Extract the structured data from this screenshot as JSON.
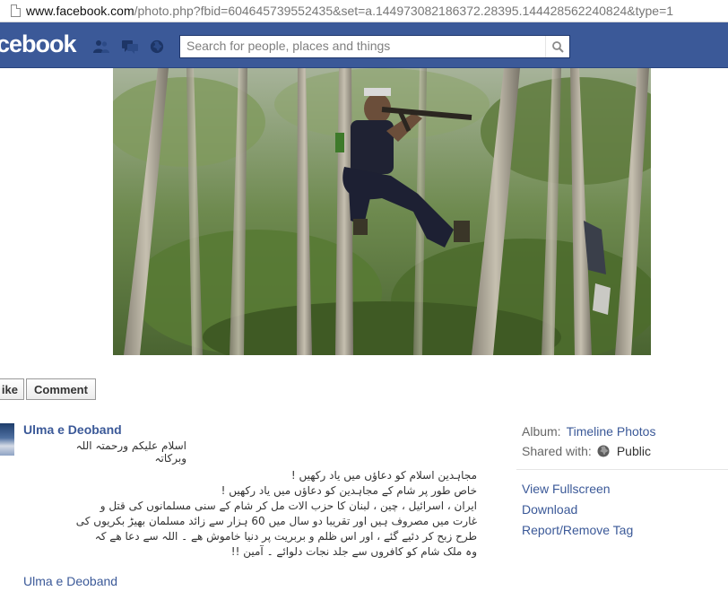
{
  "browser": {
    "url_host": "www.facebook.com",
    "url_path": "/photo.php?fbid=604645739552435&set=a.144973082186372.28395.144428562240824&type=1"
  },
  "header": {
    "logo_text": "cebook",
    "icons": [
      "friends-icon",
      "messages-icon",
      "globe-icon"
    ],
    "search_placeholder": "Search for people, places and things",
    "brand_color": "#3b5998"
  },
  "actions": {
    "like_label": "ike",
    "comment_label": "Comment"
  },
  "post": {
    "author": "Ulma e Deoband",
    "greeting": "اسلام علیکم ورحمتہ اللہ وبرکاتہ",
    "lines": [
      "مجاہدین اسلام کو دعاؤں میں یاد رکھیں !",
      "خاص طور پر شام کے مجاہدین کو دعاؤں میں یاد رکھیں !",
      "ایران ، اسرائیل ، چین ، لبنان کا حزب الات مل کر شام کے سنی مسلمانوں کی قتل و",
      "غارت میں مصروف ہیں اور تقریبا دو سال میں 60 ہزار سے زائد مسلمان بھیڑ بکریوں کی",
      "طرح زبح کر دئیے گئے ، اور اس ظلم و بربریت پر دنیا خاموش ھے ۔ اللہ سے دعا ھے کہ",
      "وہ ملک شام کو کافروں سے جلد نجات دلوائے ۔ آمین !!"
    ],
    "author_link": "Ulma e Deoband"
  },
  "sidebar": {
    "album_label": "Album:",
    "album_value": "Timeline Photos",
    "shared_label": "Shared with:",
    "shared_value": "Public",
    "links": [
      "View Fullscreen",
      "Download",
      "Report/Remove Tag"
    ]
  }
}
